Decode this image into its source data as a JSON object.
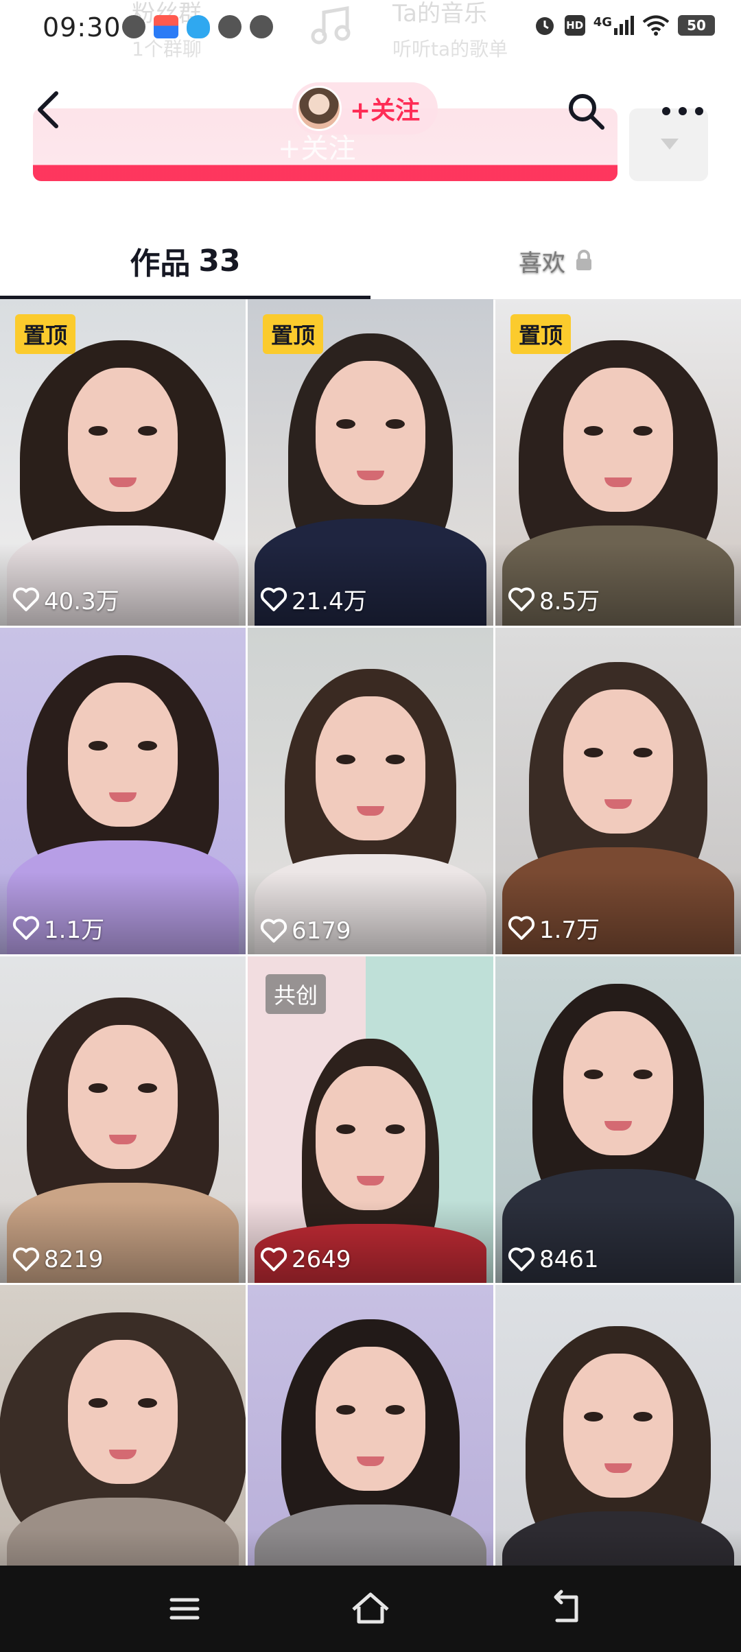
{
  "status_bar": {
    "time": "09:30",
    "network": "4G",
    "hd": "HD",
    "battery": "50"
  },
  "background_header": {
    "fans_group_title": "粉丝群",
    "fans_group_sub": "1个群聊",
    "music_title": "Ta的音乐",
    "music_sub": "听听ta的歌单",
    "follow_button": "+关注"
  },
  "nav": {
    "follow_label": "+关注"
  },
  "tabs": {
    "works_label": "作品",
    "works_count": "33",
    "likes_label": "喜欢"
  },
  "badges": {
    "pinned": "置顶",
    "collab": "共创"
  },
  "videos": [
    {
      "likes": "40.3万",
      "pinned": true,
      "collab": false
    },
    {
      "likes": "21.4万",
      "pinned": true,
      "collab": false
    },
    {
      "likes": "8.5万",
      "pinned": true,
      "collab": false
    },
    {
      "likes": "1.1万",
      "pinned": false,
      "collab": false
    },
    {
      "likes": "6179",
      "pinned": false,
      "collab": false
    },
    {
      "likes": "1.7万",
      "pinned": false,
      "collab": false
    },
    {
      "likes": "8219",
      "pinned": false,
      "collab": false
    },
    {
      "likes": "2649",
      "pinned": false,
      "collab": true
    },
    {
      "likes": "8461",
      "pinned": false,
      "collab": false
    },
    {
      "likes": "",
      "pinned": false,
      "collab": false
    },
    {
      "likes": "",
      "pinned": false,
      "collab": false
    },
    {
      "likes": "",
      "pinned": false,
      "collab": false
    }
  ],
  "colors": {
    "accent": "#fe2c55",
    "pin_badge": "#fbcb2d",
    "text_primary": "#161823",
    "text_secondary": "#7a7a7a"
  }
}
